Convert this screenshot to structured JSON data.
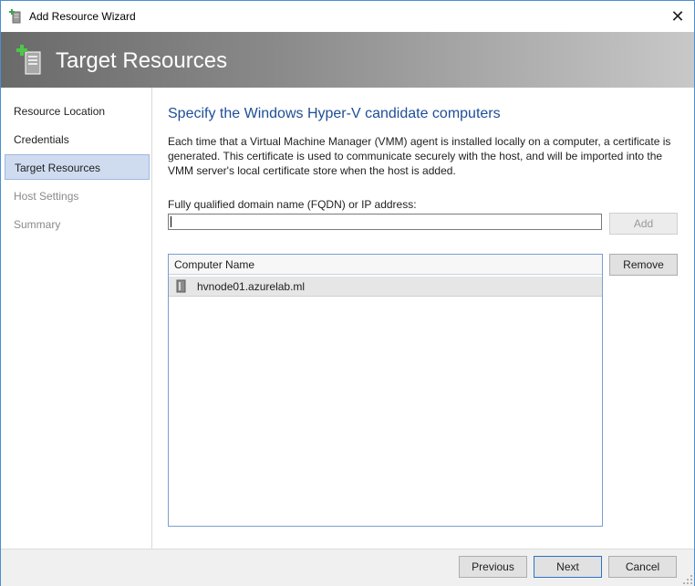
{
  "window": {
    "title": "Add Resource Wizard",
    "close_glyph": "✕"
  },
  "banner": {
    "title": "Target Resources"
  },
  "sidebar": {
    "items": [
      {
        "label": "Resource Location",
        "state": "normal"
      },
      {
        "label": "Credentials",
        "state": "normal"
      },
      {
        "label": "Target Resources",
        "state": "active"
      },
      {
        "label": "Host Settings",
        "state": "disabled"
      },
      {
        "label": "Summary",
        "state": "disabled"
      }
    ]
  },
  "main": {
    "heading": "Specify the Windows Hyper-V candidate computers",
    "description": "Each time that a Virtual Machine Manager (VMM) agent is installed locally on a computer, a certificate is generated. This certificate is used to communicate securely with the host, and will be imported into the VMM server's local certificate store when the host is added.",
    "fqdn_label": "Fully qualified domain name (FQDN) or IP address:",
    "fqdn_value": "",
    "add_label": "Add",
    "remove_label": "Remove",
    "list": {
      "column_header": "Computer Name",
      "rows": [
        {
          "name": "hvnode01.azurelab.ml"
        }
      ]
    }
  },
  "footer": {
    "previous_label": "Previous",
    "next_label": "Next",
    "cancel_label": "Cancel"
  },
  "colors": {
    "accent": "#1f4e96",
    "selection": "#cfdcf0",
    "banner_dark": "#6a6a6a"
  }
}
